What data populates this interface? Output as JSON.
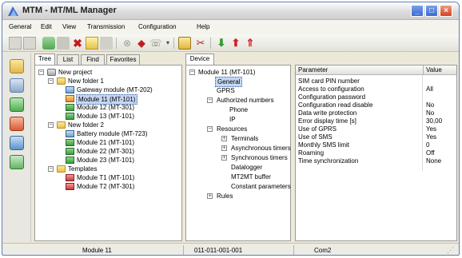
{
  "window": {
    "title": "MTM - MT/ML Manager"
  },
  "menu": {
    "items": [
      "General",
      "Edit",
      "View",
      "Transmission",
      "Configuration",
      "Help"
    ]
  },
  "left_tabs": [
    "Tree",
    "List",
    "Find",
    "Favorites"
  ],
  "tree": {
    "project": "New project",
    "folder1": "New folder 1",
    "folder1_items": [
      "Gateway module (MT-202)",
      "Module 11 (MT-101)",
      "Module 12 (MT-301)",
      "Module 13 (MT-101)"
    ],
    "folder2": "New folder 2",
    "folder2_items": [
      "Battery module (MT-723)",
      "Module 21 (MT-101)",
      "Module 22 (MT-301)",
      "Module 23 (MT-101)"
    ],
    "templates": "Templates",
    "templates_items": [
      "Module T1 (MT-101)",
      "Module T2 (MT-301)"
    ]
  },
  "device_tab": "Device",
  "device_tree": {
    "root": "Module 11 (MT-101)",
    "general": "General",
    "gprs": "GPRS",
    "authorized": "Authorized numbers",
    "phone": "Phone",
    "ip": "IP",
    "resources": "Resources",
    "terminals": "Terminals",
    "async_timers": "Asynchronous timers",
    "sync_timers": "Synchronous timers",
    "datalogger": "Datalogger",
    "mt2mt": "MT2MT buffer",
    "constant": "Constant parameters",
    "rules": "Rules"
  },
  "params": {
    "header_parameter": "Parameter",
    "header_value": "Value",
    "rows": [
      {
        "name": "SIM card PIN number",
        "value": ""
      },
      {
        "name": "Access to configuration",
        "value": "All"
      },
      {
        "name": "Configuration password",
        "value": ""
      },
      {
        "name": "Configuration read disable",
        "value": "No"
      },
      {
        "name": "Data write protection",
        "value": "No"
      },
      {
        "name": "Error display time [s]",
        "value": "30,00"
      },
      {
        "name": "Use of GPRS",
        "value": "Yes"
      },
      {
        "name": "Use of SMS",
        "value": "Yes"
      },
      {
        "name": "Monthly SMS limit",
        "value": "0"
      },
      {
        "name": "Roaming",
        "value": "Off"
      },
      {
        "name": "Time synchronization",
        "value": "None"
      }
    ]
  },
  "status": {
    "module": "Module 11",
    "address": "011-011-001-001",
    "port": "Com2"
  },
  "colors": {
    "accent": "#3c6ad0",
    "close": "#d1421f",
    "selection": "#c5d7f2"
  }
}
